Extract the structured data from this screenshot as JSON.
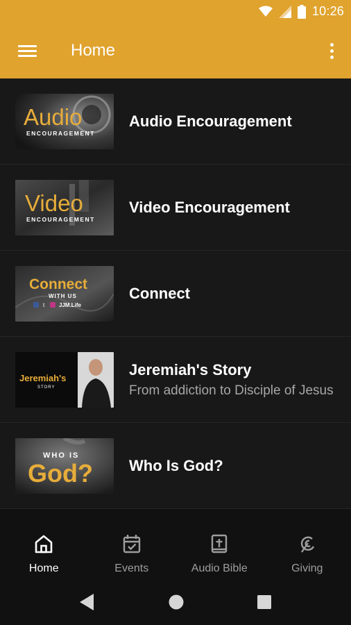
{
  "status": {
    "time": "10:26"
  },
  "toolbar": {
    "title": "Home"
  },
  "items": [
    {
      "title": "Audio Encouragement",
      "subtitle": "",
      "thumb_main": "Audio",
      "thumb_sub": "ENCOURAGEMENT"
    },
    {
      "title": "Video Encouragement",
      "subtitle": "",
      "thumb_main": "Video",
      "thumb_sub": "ENCOURAGEMENT"
    },
    {
      "title": "Connect",
      "subtitle": "",
      "thumb_main": "Connect",
      "thumb_sub": "WITH US",
      "thumb_handle": "JJM.Life"
    },
    {
      "title": "Jeremiah's Story",
      "subtitle": "From addiction to Disciple of Jesus",
      "thumb_main": "Jeremiah's",
      "thumb_sub": "STORY"
    },
    {
      "title": "Who Is God?",
      "subtitle": "",
      "thumb_top": "WHO IS",
      "thumb_main": "God?"
    }
  ],
  "nav": [
    {
      "label": "Home",
      "icon": "home-icon",
      "active": true
    },
    {
      "label": "Events",
      "icon": "calendar-check-icon",
      "active": false
    },
    {
      "label": "Audio Bible",
      "icon": "bible-icon",
      "active": false
    },
    {
      "label": "Giving",
      "icon": "giving-icon",
      "active": false
    }
  ],
  "colors": {
    "accent": "#e0a32e",
    "background": "#181818",
    "gold_text": "#e7ad3a"
  }
}
